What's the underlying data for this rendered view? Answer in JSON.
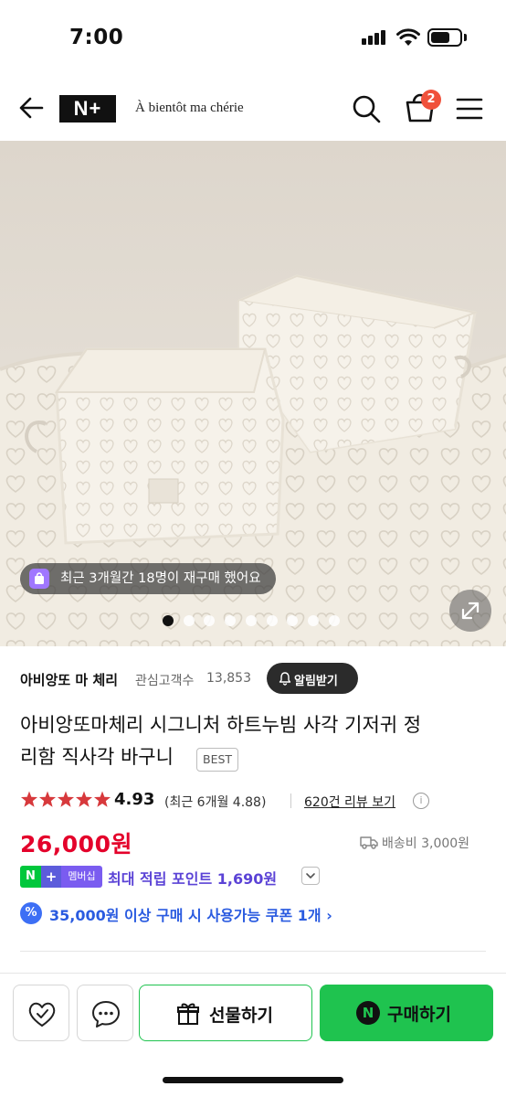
{
  "status_bar": {
    "time": "7:00"
  },
  "header": {
    "logo_text": "N+",
    "store_name": "À bientôt ma chérie",
    "cart_count": "2"
  },
  "hero": {
    "repurchase_text": "최근 3개월간 18명이 재구매 했어요",
    "slide_count": 9,
    "active_slide": 1
  },
  "store": {
    "name": "아비앙또 마 체리",
    "followers_label": "관심고객수",
    "followers_count": "13,853",
    "alert_label": "알림받기"
  },
  "product": {
    "title_line1": "아비앙또마체리 시그니처 하트누빔 사각 기저귀 정",
    "title_line2": "리함 직사각 바구니",
    "badge": "BEST",
    "rating": "4.93",
    "recent_rating": "(최근 6개월 4.88)",
    "review_link": "620건 리뷰 보기",
    "price": "26,000원",
    "shipping": "배송비 3,000원"
  },
  "membership": {
    "badge_n": "N",
    "badge_plus": "+",
    "badge_label": "멤버십",
    "text": "최대 적립 포인트 1,690원"
  },
  "coupon": {
    "icon": "%",
    "text": "35,000원 이상 구매 시 사용가능 쿠폰 1개 ›"
  },
  "bottom_bar": {
    "gift_label": "선물하기",
    "buy_icon": "N",
    "buy_label": "구매하기"
  },
  "colors": {
    "price_red": "#e4022b",
    "naver_green": "#1fc34f",
    "membership_purple": "#5b43d6",
    "coupon_blue": "#2a5be0",
    "cart_badge": "#f0513b"
  }
}
